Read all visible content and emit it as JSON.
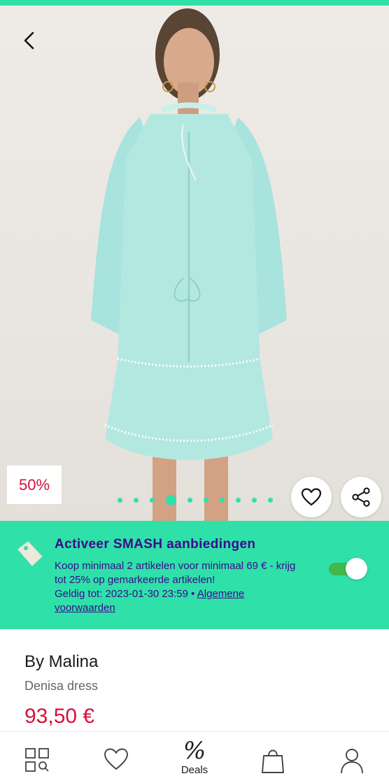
{
  "product": {
    "discount_badge": "50%",
    "brand": "By Malina",
    "name": "Denisa dress",
    "price": "93,50 €",
    "image_dots_total": 10,
    "image_dots_active": 3
  },
  "promo": {
    "title": "Activeer SMASH aanbiedingen",
    "description": "Koop minimaal 2 artikelen voor minimaal 69 € - krijg tot 25% op gemarkeerde artikelen!",
    "valid_prefix": "Geldig tot: 2023-01-30 23:59 • ",
    "terms_link": "Algemene voorwaarden",
    "toggle_on": true
  },
  "nav": {
    "deals_symbol": "%",
    "deals_label": "Deals"
  },
  "colors": {
    "accent": "#2fe0a9",
    "promo_text": "#3b0a8c",
    "price": "#d6113a",
    "toggle": "#41b84a"
  },
  "icons": {
    "back": "chevron-left-icon",
    "favorite": "heart-icon",
    "share": "share-icon",
    "tag": "tag-icon",
    "categories": "categories-search-icon",
    "wishlist": "heart-icon",
    "cart": "shopping-bag-icon",
    "account": "user-icon"
  }
}
